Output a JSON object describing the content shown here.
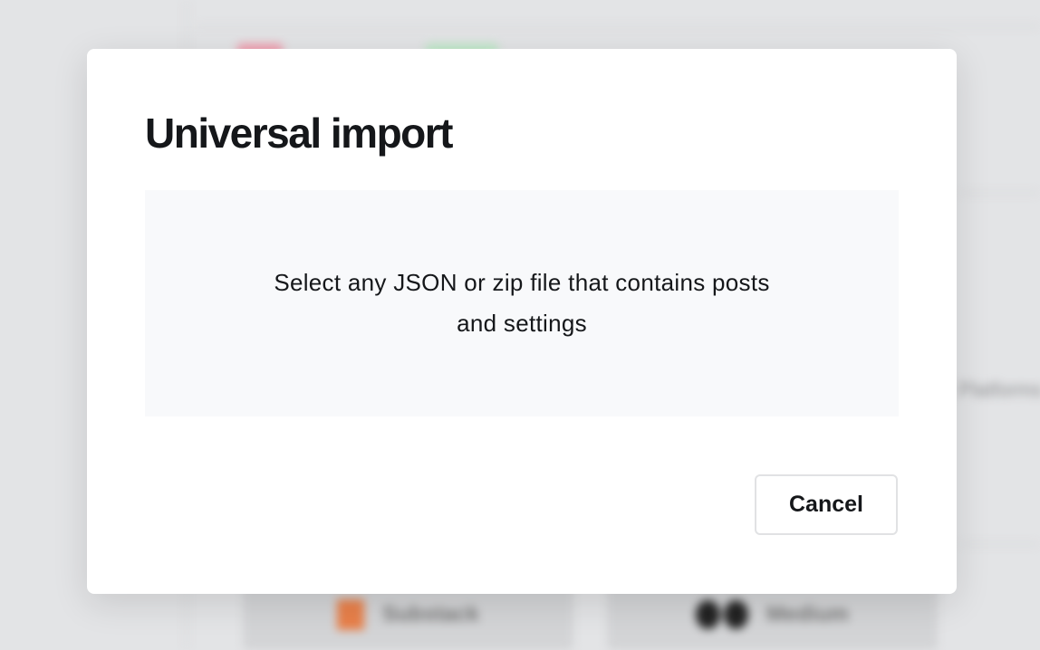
{
  "background": {
    "side_text": "Platforms",
    "importers": [
      {
        "label": "Substack",
        "icon": "substack-icon",
        "color": "#e8804a"
      },
      {
        "label": "Medium",
        "icon": "medium-icon",
        "color": "#222222"
      }
    ]
  },
  "modal": {
    "title": "Universal import",
    "dropzone_text": "Select any JSON or zip file that contains posts and settings",
    "cancel_label": "Cancel"
  }
}
